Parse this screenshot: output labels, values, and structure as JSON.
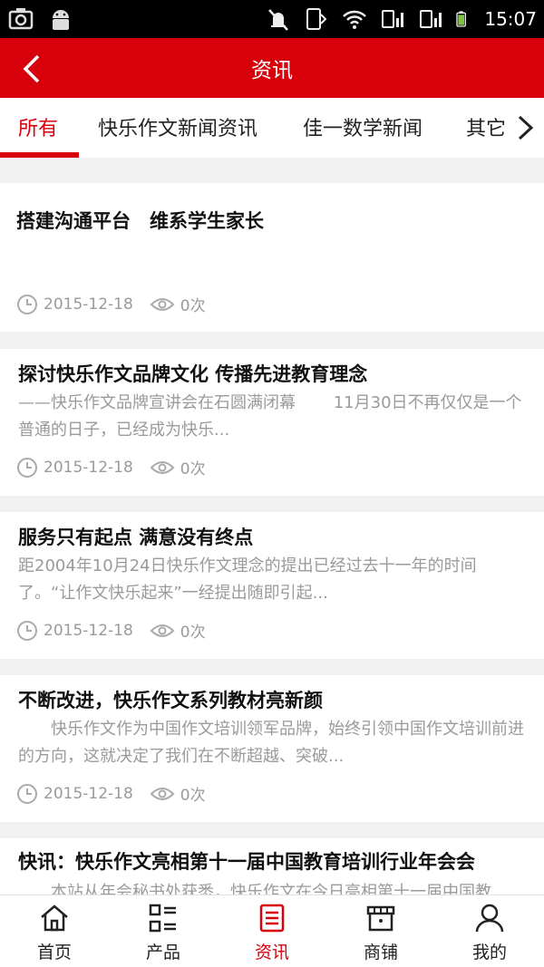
{
  "status_bar": {
    "time": "15:07"
  },
  "header": {
    "title": "资讯"
  },
  "tabs": [
    {
      "label": "所有",
      "active": true
    },
    {
      "label": "快乐作文新闻资讯",
      "active": false
    },
    {
      "label": "佳一数学新闻",
      "active": false
    },
    {
      "label": "其它",
      "active": false
    }
  ],
  "articles": [
    {
      "title": "搭建沟通平台　维系学生家长",
      "desc": "",
      "date": "2015-12-18",
      "views": "0次"
    },
    {
      "title": "探讨快乐作文品牌文化 传播先进教育理念",
      "desc": "——快乐作文品牌宣讲会在石圆满闭幕　　 11月30日不再仅仅是一个普通的日子，已经成为快乐...",
      "date": "2015-12-18",
      "views": "0次"
    },
    {
      "title": "服务只有起点 满意没有终点",
      "desc": "距2004年10月24日快乐作文理念的提出已经过去十一年的时间了。“让作文快乐起来”一经提出随即引起...",
      "date": "2015-12-18",
      "views": "0次"
    },
    {
      "title": "不断改进，快乐作文系列教材亮新颜",
      "desc": "　　快乐作文作为中国作文培训领军品牌，始终引领中国作文培训前进的方向，这就决定了我们在不断超越、突破...",
      "date": "2015-12-18",
      "views": "0次"
    },
    {
      "title": "快讯：快乐作文亮相第十一届中国教育培训行业年会会",
      "desc": "　　本站从年会秘书处获悉，快乐作文在今日亮相第十一届中国教",
      "date": "",
      "views": ""
    }
  ],
  "bottom_nav": [
    {
      "label": "首页",
      "icon": "home-icon",
      "active": false
    },
    {
      "label": "产品",
      "icon": "grid-list-icon",
      "active": false
    },
    {
      "label": "资讯",
      "icon": "news-icon",
      "active": true
    },
    {
      "label": "商铺",
      "icon": "shop-icon",
      "active": false
    },
    {
      "label": "我的",
      "icon": "user-icon",
      "active": false
    }
  ],
  "colors": {
    "accent": "#d8000b",
    "meta_gray": "#9a9a9a",
    "background": "#f1f1f1"
  }
}
